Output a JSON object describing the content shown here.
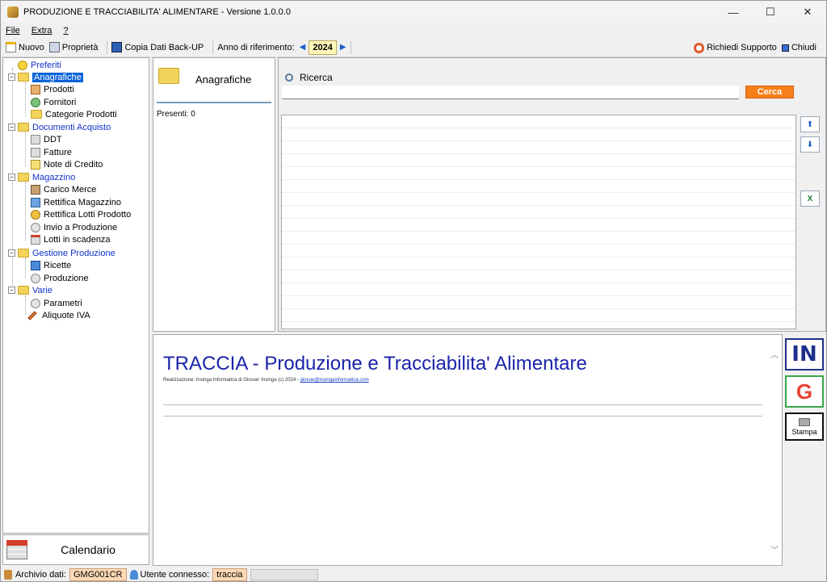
{
  "window": {
    "title": "PRODUZIONE E TRACCIABILITA' ALIMENTARE - Versione 1.0.0.0",
    "controls": [
      "—",
      "☐",
      "✕"
    ]
  },
  "menu": [
    "File",
    "Extra",
    "?"
  ],
  "toolbar": {
    "nuovo": "Nuovo",
    "proprieta": "Proprietà",
    "copia": "Copia Dati Back-UP",
    "anno_label": "Anno di riferimento:",
    "anno": "2024",
    "supporto": "Richiedi Supporto",
    "chiudi": "Chiudi"
  },
  "tree": {
    "preferiti": "Preferiti",
    "anagrafiche": "Anagrafiche",
    "prodotti": "Prodotti",
    "fornitori": "Fornitori",
    "categorie": "Categorie Prodotti",
    "documenti": "Documenti Acquisto",
    "ddt": "DDT",
    "fatture": "Fatture",
    "note": "Note di Credito",
    "magazzino": "Magazzino",
    "carico": "Carico Merce",
    "rettifica_mag": "Rettifica Magazzino",
    "rettifica_lotti": "Rettifica Lotti Prodotto",
    "invio": "Invio a Produzione",
    "lotti": "Lotti in scadenza",
    "gestione": "Gestione Produzione",
    "ricette": "Ricette",
    "produzione": "Produzione",
    "varie": "Varie",
    "parametri": "Parametri",
    "aliquote": "Aliquote IVA"
  },
  "calendario": "Calendario",
  "middle": {
    "title": "Anagrafiche",
    "count": "Presenti: 0"
  },
  "search": {
    "label": "Ricerca",
    "value": "",
    "button": "Cerca"
  },
  "bottom": {
    "title": "TRACCIA - Produzione e Tracciabilita' Alimentare",
    "credits": "Realizzazione: Insinga Informatica di Giosue' Insinga (c) 2024 - ",
    "email": "giosue@insingainformatica.com",
    "stampa": "Stampa"
  },
  "status": {
    "archivio_label": "Archivio dati:",
    "archivio": "GMG001CR",
    "utente_label": "Utente connesso:",
    "utente": "traccia"
  }
}
